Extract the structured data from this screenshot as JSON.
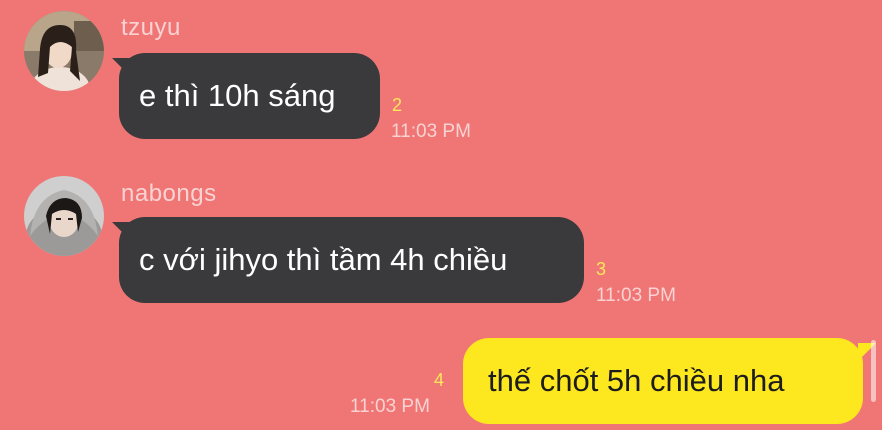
{
  "messages": [
    {
      "sender": "tzuyu",
      "text": "e thì 10h sáng",
      "unread": "2",
      "time": "11:03 PM"
    },
    {
      "sender": "nabongs",
      "text": "c với jihyo thì tầm 4h chiều",
      "unread": "3",
      "time": "11:03 PM"
    },
    {
      "sender": "",
      "text": "thế chốt 5h chiều nha",
      "unread": "4",
      "time": "11:03 PM"
    }
  ],
  "colors": {
    "background": "#f07676",
    "incoming_bubble": "#3a3a3c",
    "outgoing_bubble": "#fde71e",
    "unread_count": "#ffe65a"
  }
}
